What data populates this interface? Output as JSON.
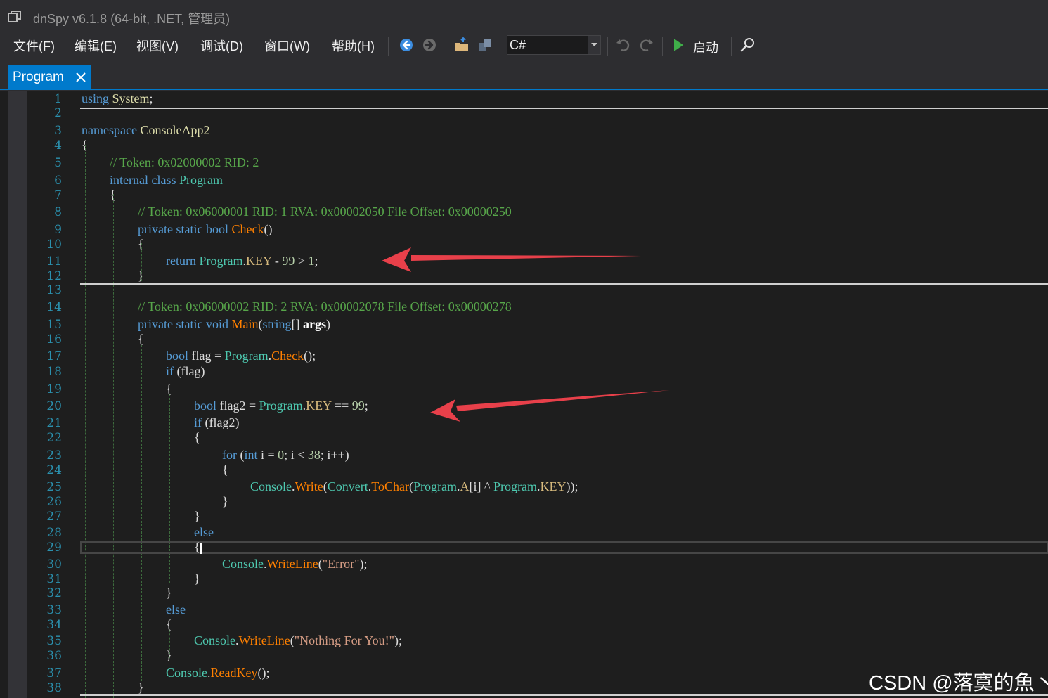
{
  "window": {
    "title": "dnSpy v6.1.8 (64-bit, .NET, 管理员)"
  },
  "menu": {
    "file": "文件(F)",
    "edit": "编辑(E)",
    "view": "视图(V)",
    "debug": "调试(D)",
    "window": "窗口(W)",
    "help": "帮助(H)"
  },
  "toolbar": {
    "language": "C#",
    "start_label": "启动",
    "icons": [
      "back-icon",
      "forward-icon",
      "open-file-icon",
      "open-list-icon",
      "undo-icon",
      "redo-icon",
      "start-icon",
      "search-icon"
    ]
  },
  "tab": {
    "label": "Program",
    "close": "✕"
  },
  "editor": {
    "accent": "#007acc",
    "line_numbers": [
      "1",
      "2",
      "3",
      "4",
      "5",
      "6",
      "7",
      "8",
      "9",
      "10",
      "11",
      "12",
      "13",
      "14",
      "15",
      "16",
      "17",
      "18",
      "19",
      "20",
      "21",
      "22",
      "23",
      "24",
      "25",
      "26",
      "27",
      "28",
      "29",
      "30",
      "31",
      "32",
      "33",
      "34",
      "35",
      "36",
      "37",
      "38"
    ],
    "lines": {
      "l1": [
        [
          "kw",
          "using"
        ],
        [
          "p",
          " "
        ],
        [
          "ns",
          "System"
        ],
        [
          "p",
          ";"
        ]
      ],
      "l3": [
        [
          "kw",
          "namespace"
        ],
        [
          "p",
          " "
        ],
        [
          "ns",
          "ConsoleApp2"
        ]
      ],
      "l4": [
        [
          "p",
          "{"
        ]
      ],
      "l5": [
        [
          "cm",
          "// Token: 0x02000002 RID: 2"
        ]
      ],
      "l6": [
        [
          "kw",
          "internal"
        ],
        [
          "p",
          " "
        ],
        [
          "kw",
          "class"
        ],
        [
          "p",
          " "
        ],
        [
          "type",
          "Program"
        ]
      ],
      "l7": [
        [
          "p",
          "{"
        ]
      ],
      "l8": [
        [
          "cm",
          "// Token: 0x06000001 RID: 1 RVA: 0x00002050 File Offset: 0x00000250"
        ]
      ],
      "l9": [
        [
          "kw",
          "private"
        ],
        [
          "p",
          " "
        ],
        [
          "kw",
          "static"
        ],
        [
          "p",
          " "
        ],
        [
          "kw",
          "bool"
        ],
        [
          "p",
          " "
        ],
        [
          "m",
          "Check"
        ],
        [
          "p",
          "()"
        ]
      ],
      "l10": [
        [
          "p",
          "{"
        ]
      ],
      "l11": [
        [
          "kw",
          "return"
        ],
        [
          "p",
          " "
        ],
        [
          "type",
          "Program"
        ],
        [
          "p",
          "."
        ],
        [
          "fld",
          "KEY"
        ],
        [
          "p",
          " - "
        ],
        [
          "num",
          "99"
        ],
        [
          "p",
          " > "
        ],
        [
          "num",
          "1"
        ],
        [
          "p",
          ";"
        ]
      ],
      "l12": [
        [
          "p",
          "}"
        ]
      ],
      "l14": [
        [
          "cm",
          "// Token: 0x06000002 RID: 2 RVA: 0x00002078 File Offset: 0x00000278"
        ]
      ],
      "l15": [
        [
          "kw",
          "private"
        ],
        [
          "p",
          " "
        ],
        [
          "kw",
          "static"
        ],
        [
          "p",
          " "
        ],
        [
          "kw",
          "void"
        ],
        [
          "p",
          " "
        ],
        [
          "m",
          "Main"
        ],
        [
          "p",
          "("
        ],
        [
          "kw",
          "string"
        ],
        [
          "p",
          "[] "
        ],
        [
          "arg",
          "args"
        ],
        [
          "p",
          ")"
        ]
      ],
      "l16": [
        [
          "p",
          "{"
        ]
      ],
      "l17": [
        [
          "kw",
          "bool"
        ],
        [
          "p",
          " flag = "
        ],
        [
          "type",
          "Program"
        ],
        [
          "p",
          "."
        ],
        [
          "m",
          "Check"
        ],
        [
          "p",
          "();"
        ]
      ],
      "l18": [
        [
          "kw",
          "if"
        ],
        [
          "p",
          " (flag)"
        ]
      ],
      "l19": [
        [
          "p",
          "{"
        ]
      ],
      "l20": [
        [
          "kw",
          "bool"
        ],
        [
          "p",
          " flag2 = "
        ],
        [
          "type",
          "Program"
        ],
        [
          "p",
          "."
        ],
        [
          "fld",
          "KEY"
        ],
        [
          "p",
          " == "
        ],
        [
          "num",
          "99"
        ],
        [
          "p",
          ";"
        ]
      ],
      "l21": [
        [
          "kw",
          "if"
        ],
        [
          "p",
          " (flag2)"
        ]
      ],
      "l22": [
        [
          "p",
          "{"
        ]
      ],
      "l23": [
        [
          "kw",
          "for"
        ],
        [
          "p",
          " ("
        ],
        [
          "kw",
          "int"
        ],
        [
          "p",
          " i = "
        ],
        [
          "num",
          "0"
        ],
        [
          "p",
          "; i < "
        ],
        [
          "num",
          "38"
        ],
        [
          "p",
          "; i++)"
        ]
      ],
      "l24": [
        [
          "p",
          "{"
        ]
      ],
      "l25": [
        [
          "stat",
          "Console"
        ],
        [
          "p",
          "."
        ],
        [
          "m",
          "Write"
        ],
        [
          "p",
          "("
        ],
        [
          "stat",
          "Convert"
        ],
        [
          "p",
          "."
        ],
        [
          "m",
          "ToChar"
        ],
        [
          "p",
          "("
        ],
        [
          "type",
          "Program"
        ],
        [
          "p",
          "."
        ],
        [
          "fld",
          "A"
        ],
        [
          "p",
          "[i] ^ "
        ],
        [
          "type",
          "Program"
        ],
        [
          "p",
          "."
        ],
        [
          "fld",
          "KEY"
        ],
        [
          "p",
          "));"
        ]
      ],
      "l26": [
        [
          "p",
          "}"
        ]
      ],
      "l27": [
        [
          "p",
          "}"
        ]
      ],
      "l28": [
        [
          "kw",
          "else"
        ]
      ],
      "l29": [
        [
          "p",
          "{"
        ]
      ],
      "l30": [
        [
          "stat",
          "Console"
        ],
        [
          "p",
          "."
        ],
        [
          "m",
          "WriteLine"
        ],
        [
          "p",
          "("
        ],
        [
          "str",
          "\"Error\""
        ],
        [
          "p",
          ");"
        ]
      ],
      "l31": [
        [
          "p",
          "}"
        ]
      ],
      "l32": [
        [
          "p",
          "}"
        ]
      ],
      "l33": [
        [
          "kw",
          "else"
        ]
      ],
      "l34": [
        [
          "p",
          "{"
        ]
      ],
      "l35": [
        [
          "stat",
          "Console"
        ],
        [
          "p",
          "."
        ],
        [
          "m",
          "WriteLine"
        ],
        [
          "p",
          "("
        ],
        [
          "str",
          "\"Nothing For You!\""
        ],
        [
          "p",
          ");"
        ]
      ],
      "l36": [
        [
          "p",
          "}"
        ]
      ],
      "l37": [
        [
          "stat",
          "Console"
        ],
        [
          "p",
          "."
        ],
        [
          "m",
          "ReadKey"
        ],
        [
          "p",
          "();"
        ]
      ],
      "l38": [
        [
          "p",
          "}"
        ]
      ]
    }
  },
  "watermark": "CSDN @落寞的魚丶",
  "annotation_color": "#e8404a"
}
